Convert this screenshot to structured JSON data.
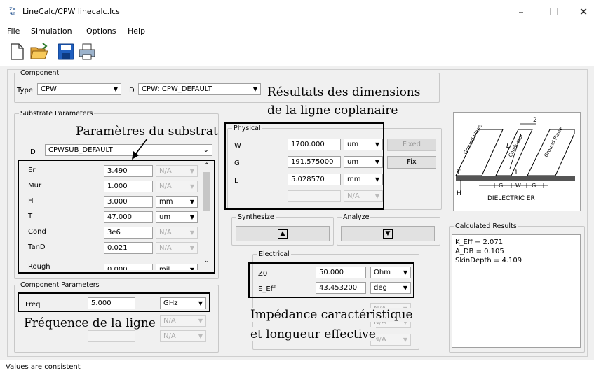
{
  "window": {
    "title": "LineCalc/CPW linecalc.lcs",
    "icon_text_top": "Z=",
    "icon_text_bottom": "50"
  },
  "menu": [
    "File",
    "Simulation",
    "Options",
    "Help"
  ],
  "toolbar": {
    "icons": [
      "new-file-icon",
      "open-folder-icon",
      "save-icon",
      "print-icon"
    ]
  },
  "component": {
    "title": "Component",
    "type_label": "Type",
    "type_value": "CPW",
    "id_label": "ID",
    "id_value": "CPW: CPW_DEFAULT"
  },
  "substrate": {
    "title": "Substrate Parameters",
    "id_label": "ID",
    "id_value": "CPWSUB_DEFAULT",
    "rows": [
      {
        "name": "Er",
        "value": "3.490",
        "unit": "N/A",
        "unit_enabled": false
      },
      {
        "name": "Mur",
        "value": "1.000",
        "unit": "N/A",
        "unit_enabled": false
      },
      {
        "name": "H",
        "value": "3.000",
        "unit": "mm",
        "unit_enabled": true
      },
      {
        "name": "T",
        "value": "47.000",
        "unit": "um",
        "unit_enabled": true
      },
      {
        "name": "Cond",
        "value": "3e6",
        "unit": "N/A",
        "unit_enabled": false
      },
      {
        "name": "TanD",
        "value": "0.021",
        "unit": "N/A",
        "unit_enabled": false
      },
      {
        "name": "Rough",
        "value": "0.000",
        "unit": "mil",
        "unit_enabled": true
      }
    ]
  },
  "component_params": {
    "title": "Component Parameters",
    "freq_label": "Freq",
    "freq_value": "5.000",
    "freq_unit": "GHz",
    "extra_units": [
      "N/A",
      "N/A"
    ]
  },
  "physical": {
    "title": "Physical",
    "rows": [
      {
        "name": "W",
        "value": "1700.000",
        "unit": "um"
      },
      {
        "name": "G",
        "value": "191.575000",
        "unit": "um"
      },
      {
        "name": "L",
        "value": "5.028570",
        "unit": "mm"
      }
    ],
    "extra_unit": "N/A",
    "fixed_label": "Fixed",
    "fix_label": "Fix"
  },
  "synthesize_label": "Synthesize",
  "analyze_label": "Analyze",
  "electrical": {
    "title": "Electrical",
    "rows": [
      {
        "name": "Z0",
        "value": "50.000",
        "unit": "Ohm"
      },
      {
        "name": "E_Eff",
        "value": "43.453200",
        "unit": "deg"
      }
    ],
    "extra_units": [
      "N/A",
      "N/A",
      "N/A"
    ]
  },
  "diagram": {
    "ground_plane": "Ground Plane",
    "conductor": "Conductor",
    "label_2": "2",
    "label_1": "1",
    "L": "L",
    "T": "T",
    "H": "H",
    "G": "G",
    "W": "W",
    "dielectric": "DIELECTRIC ER"
  },
  "results": {
    "title": "Calculated Results",
    "lines": [
      "K_Eff = 2.071",
      "A_DB = 0.105",
      "SkinDepth = 4.109"
    ]
  },
  "status": "Values are consistent",
  "annotations": {
    "substrate": "Paramètres du substrat",
    "dims_line1": "Résultats des dimensions",
    "dims_line2": "de la ligne coplanaire",
    "freq": "Fréquence de la ligne",
    "imp_line1": "Impédance caractéristique",
    "imp_line2": "et longueur effective"
  }
}
